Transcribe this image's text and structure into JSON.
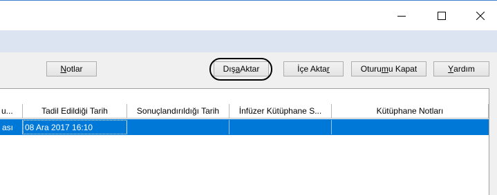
{
  "window": {
    "controls": [
      "minimize-icon",
      "maximize-icon",
      "close-icon"
    ]
  },
  "toolbar": {
    "notes": {
      "pre": "",
      "u": "N",
      "post": "otlar"
    },
    "export": {
      "pre": "Dış",
      "u": "a",
      "post": " Aktar"
    },
    "import": {
      "pre": "İçe Akta",
      "u": "r",
      "post": ""
    },
    "logout": {
      "pre": "Oturu",
      "u": "m",
      "post": "u Kapat"
    },
    "help": {
      "pre": "",
      "u": "Y",
      "post": "ardım"
    }
  },
  "table": {
    "headers": [
      "u...",
      "Tadil Edildiği Tarih",
      "Sonuçlandırıldığı Tarih",
      "İnfüzer Kütüphane S...",
      "Kütüphane Notları"
    ],
    "rows": [
      [
        "ası",
        "08 Ara 2017 16:10",
        "",
        "",
        ""
      ]
    ],
    "selected_row_color": "#0078d7"
  }
}
